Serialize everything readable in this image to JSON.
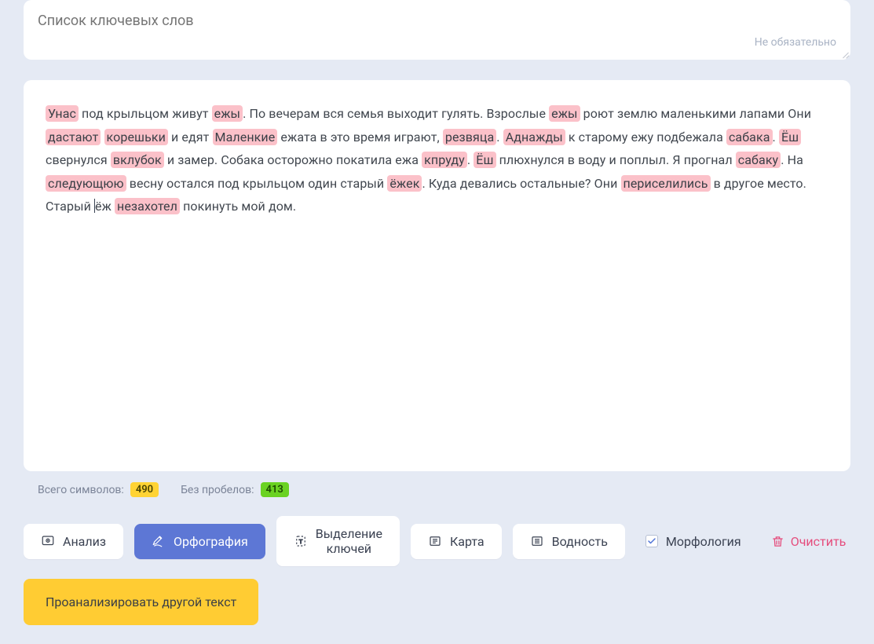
{
  "keywords": {
    "placeholder": "Список ключевых слов",
    "hint": "Не обязательно"
  },
  "text": {
    "parts": [
      {
        "t": "Унас",
        "e": true
      },
      {
        "t": " под крыльцом живут "
      },
      {
        "t": "ежы",
        "e": true
      },
      {
        "t": ". По вечерам вся семья выходит гулять. Взрослые "
      },
      {
        "t": "ежы",
        "e": true
      },
      {
        "t": " роют землю маленькими лапами Они "
      },
      {
        "t": "дастают",
        "e": true
      },
      {
        "t": " "
      },
      {
        "t": "корешьки",
        "e": true
      },
      {
        "t": " и едят "
      },
      {
        "t": "Маленкие",
        "e": true
      },
      {
        "t": " ежата в это время играют, "
      },
      {
        "t": "резвяца",
        "e": true
      },
      {
        "t": ". "
      },
      {
        "t": "Аднажды",
        "e": true
      },
      {
        "t": " к старому ежу подбежала "
      },
      {
        "t": "сабака",
        "e": true
      },
      {
        "t": ". "
      },
      {
        "t": "Ёш",
        "e": true
      },
      {
        "t": " свернулся "
      },
      {
        "t": "вклубок",
        "e": true
      },
      {
        "t": " и замер. Собака осторожно покатила ежа "
      },
      {
        "t": "кпруду",
        "e": true
      },
      {
        "t": ". "
      },
      {
        "t": "Ёш",
        "e": true
      },
      {
        "t": " плюхнулся в воду и поплыл. Я прогнал "
      },
      {
        "t": "сабаку",
        "e": true
      },
      {
        "t": ". На "
      },
      {
        "t": "следующюю",
        "e": true
      },
      {
        "t": " весну остался под крыльцом один старый "
      },
      {
        "t": "ёжек",
        "e": true
      },
      {
        "t": ". Куда девались остальные? Они "
      },
      {
        "t": "периселились",
        "e": true
      },
      {
        "t": " в другое место. Старый ",
        "cursorBefore": "ё"
      },
      {
        "t": "ёж ",
        "cursor": true
      },
      {
        "t": "незахотел",
        "e": true
      },
      {
        "t": " покинуть мой дом."
      }
    ]
  },
  "stats": {
    "total_label": "Всего символов:",
    "total_value": "490",
    "nospaces_label": "Без пробелов:",
    "nospaces_value": "413"
  },
  "toolbar": {
    "analysis": "Анализ",
    "spelling": "Орфография",
    "keys": "Выделение ключей",
    "map": "Карта",
    "water": "Водность",
    "morph": "Морфология",
    "clear": "Очистить"
  },
  "primary_action": "Проанализировать другой текст"
}
